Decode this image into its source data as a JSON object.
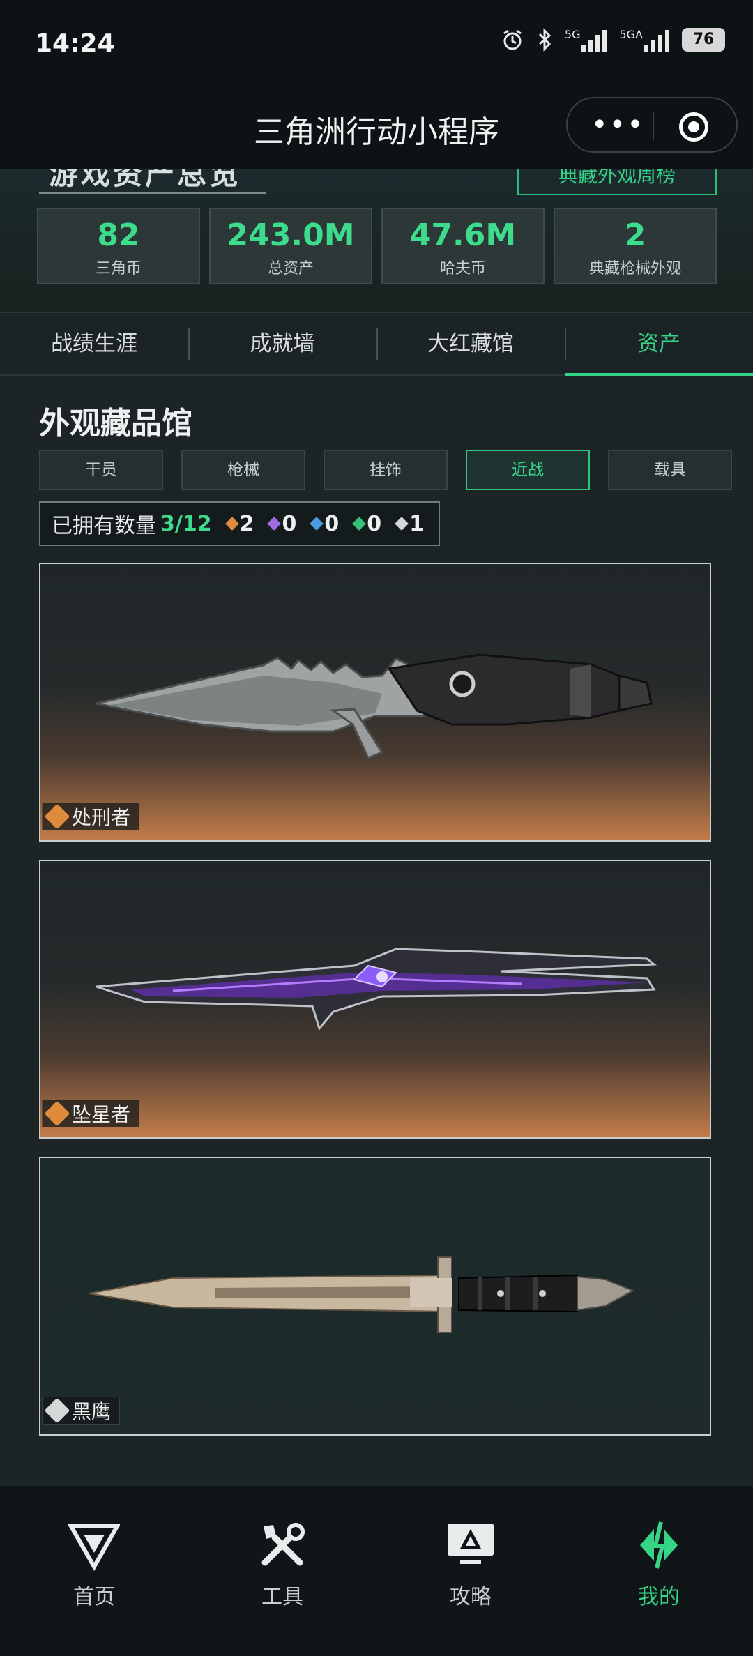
{
  "status_bar": {
    "time": "14:24",
    "net1": "5G",
    "net2": "5GA",
    "battery": "76"
  },
  "title_bar": {
    "title": "三角洲行动小程序"
  },
  "stats_header": {
    "heading_partial": "游戏资产总览",
    "link_partial": "典藏外观周榜"
  },
  "stats": [
    {
      "value": "82",
      "label": "三角币"
    },
    {
      "value": "243.0M",
      "label": "总资产"
    },
    {
      "value": "47.6M",
      "label": "哈夫币"
    },
    {
      "value": "2",
      "label": "典藏枪械外观"
    }
  ],
  "tabs": [
    {
      "label": "战绩生涯",
      "active": false
    },
    {
      "label": "成就墙",
      "active": false
    },
    {
      "label": "大红藏馆",
      "active": false
    },
    {
      "label": "资产",
      "active": true
    }
  ],
  "collection": {
    "title": "外观藏品馆",
    "filters": [
      {
        "label": "干员",
        "active": false
      },
      {
        "label": "枪械",
        "active": false
      },
      {
        "label": "挂饰",
        "active": false
      },
      {
        "label": "近战",
        "active": true
      },
      {
        "label": "载具",
        "active": false
      }
    ],
    "owned_label": "已拥有数量",
    "owned_count": "3/12",
    "rarity_counts": [
      {
        "color": "#e08a3c",
        "count": "2"
      },
      {
        "color": "#a06be0",
        "count": "0"
      },
      {
        "color": "#4a9be0",
        "count": "0"
      },
      {
        "color": "#35c27a",
        "count": "0"
      },
      {
        "color": "#d4d8d8",
        "count": "1"
      }
    ],
    "items": [
      {
        "name": "处刑者",
        "rarity_color": "#e08a3c"
      },
      {
        "name": "坠星者",
        "rarity_color": "#e08a3c"
      },
      {
        "name": "黑鹰",
        "rarity_color": "#d4d8d8"
      }
    ]
  },
  "bottom_nav": [
    {
      "label": "首页",
      "icon": "home-logo-icon",
      "active": false
    },
    {
      "label": "工具",
      "icon": "tools-icon",
      "active": false
    },
    {
      "label": "攻略",
      "icon": "guide-monitor-icon",
      "active": false
    },
    {
      "label": "我的",
      "icon": "profile-logo-icon",
      "active": true
    }
  ],
  "colors": {
    "accent": "#36d487",
    "background": "#1b2326"
  }
}
